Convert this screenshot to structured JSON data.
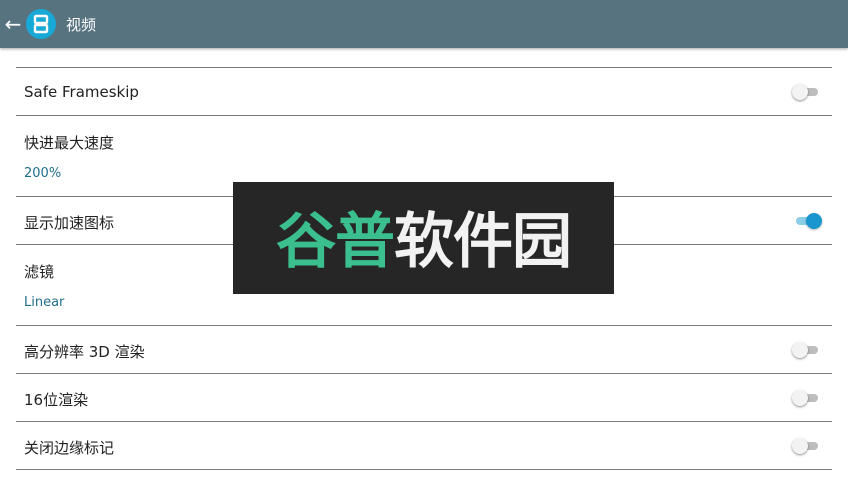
{
  "appbar": {
    "title": "视频",
    "back_icon": "arrow-left-icon",
    "app_icon": "app-logo-icon",
    "colors": {
      "background": "#587380",
      "icon_bg": "#18a9d6"
    }
  },
  "settings": {
    "items": [
      {
        "title": "Safe Frameskip",
        "toggle": "off"
      },
      {
        "title": "快进最大速度",
        "value": "200%"
      },
      {
        "title": "显示加速图标",
        "toggle": "on"
      },
      {
        "title": "滤镜",
        "value": "Linear"
      },
      {
        "title": "高分辨率 3D 渲染",
        "toggle": "off"
      },
      {
        "title": "16位渲染",
        "toggle": "off"
      },
      {
        "title": "关闭边缘标记",
        "toggle": "off"
      }
    ],
    "colors": {
      "accent": "#1a96cf",
      "value_text": "#1f6e8c",
      "divider": "#7a7a7a"
    }
  },
  "watermark": {
    "green_text": "谷普",
    "white_text": "软件园"
  }
}
